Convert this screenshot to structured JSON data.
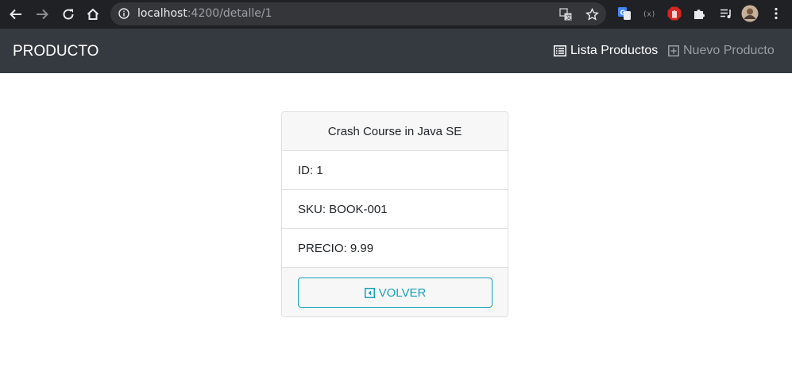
{
  "browser": {
    "url_host": "localhost",
    "url_path": ":4200/detalle/1"
  },
  "navbar": {
    "brand": "PRODUCTO",
    "links": [
      {
        "label": "Lista Productos",
        "icon": "list-icon"
      },
      {
        "label": "Nuevo Producto",
        "icon": "plus-square-icon"
      }
    ]
  },
  "product": {
    "title": "Crash Course in Java SE",
    "fields": [
      {
        "text": "ID: 1"
      },
      {
        "text": "SKU: BOOK-001"
      },
      {
        "text": "PRECIO: 9.99"
      }
    ],
    "back_button": "VOLVER"
  },
  "colors": {
    "navbar_bg": "#343a40",
    "accent": "#17a2b8",
    "chrome_bg": "#202124"
  }
}
